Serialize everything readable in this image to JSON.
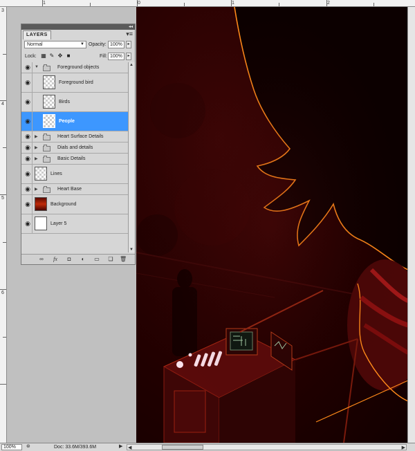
{
  "ruler": {
    "top_labels": [
      "1",
      "0",
      "1",
      "2"
    ],
    "left_labels": [
      "3",
      "4",
      "5",
      "6"
    ]
  },
  "layers_panel": {
    "tab_label": "LAYERS",
    "collapse_glyph": "◂◂",
    "menu_glyph": "▾≡",
    "blend_mode": "Normal",
    "opacity_label": "Opacity:",
    "opacity_value": "100%",
    "lock_label": "Lock:",
    "fill_label": "Fill:",
    "fill_value": "100%",
    "layers": [
      {
        "name": "Foreground objects",
        "kind": "group",
        "expanded": true,
        "visible": true,
        "selected": false
      },
      {
        "name": "Foreground bird",
        "kind": "layer",
        "thumb": "transparent",
        "visible": true,
        "selected": false
      },
      {
        "name": "Birds",
        "kind": "layer",
        "thumb": "transparent",
        "visible": true,
        "selected": false
      },
      {
        "name": "People",
        "kind": "layer",
        "thumb": "transparent",
        "visible": true,
        "selected": true
      },
      {
        "name": "Heart Surface Details",
        "kind": "group",
        "expanded": false,
        "visible": true,
        "selected": false
      },
      {
        "name": "Dials and details",
        "kind": "group",
        "expanded": false,
        "visible": true,
        "selected": false
      },
      {
        "name": "Basic Details",
        "kind": "group",
        "expanded": false,
        "visible": true,
        "selected": false
      },
      {
        "name": "Lines",
        "kind": "layer",
        "thumb": "transparent",
        "visible": true,
        "selected": false
      },
      {
        "name": "Heart Base",
        "kind": "group",
        "expanded": false,
        "visible": true,
        "selected": false
      },
      {
        "name": "Background",
        "kind": "layer",
        "thumb": "background",
        "visible": true,
        "selected": false
      },
      {
        "name": "Layer 5",
        "kind": "layer",
        "thumb": "white",
        "visible": true,
        "selected": false
      }
    ],
    "footer_icons": [
      "link-icon",
      "fx-icon",
      "mask-icon",
      "adjustment-icon",
      "group-icon",
      "new-layer-icon",
      "trash-icon"
    ]
  },
  "status_bar": {
    "zoom": "100%",
    "doc_info": "Doc: 33.6M/393.6M"
  },
  "colors": {
    "selection": "#3d97ff",
    "panel_bg": "#d6d6d6",
    "canvas_dark": "#200000",
    "outline_orange": "#ff8a1a"
  }
}
